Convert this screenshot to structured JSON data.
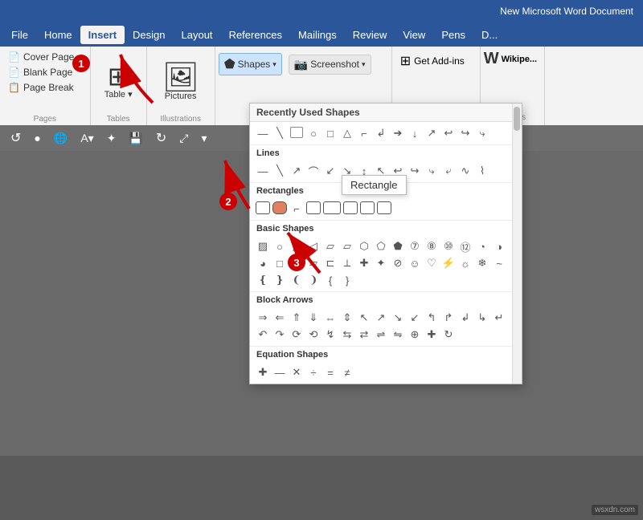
{
  "titlebar": {
    "text": "New Microsoft Word Document"
  },
  "menubar": {
    "items": [
      "File",
      "Home",
      "Insert",
      "Design",
      "Layout",
      "References",
      "Mailings",
      "Review",
      "View",
      "Pens",
      "D..."
    ]
  },
  "pages_group": {
    "label": "Pages",
    "buttons": [
      "Cover Page",
      "Blank Page",
      "Page Break"
    ]
  },
  "tables_group": {
    "label": "Tables",
    "button": "Table"
  },
  "illustrations_group": {
    "label": "Illustrations",
    "button": "Pictures"
  },
  "shapes_group": {
    "shapes_label": "Shapes",
    "screenshot_label": "Screenshot"
  },
  "addins_group": {
    "label": "Add-ins",
    "button": "Get Add-ins"
  },
  "dropdown": {
    "sections": [
      {
        "name": "Recently Used Shapes",
        "shapes": [
          "▭",
          "\\",
          "╲",
          "□",
          "○",
          "◁",
          "△",
          "⌐",
          "⌐",
          "→",
          "↓",
          "⌐",
          "⌐",
          "⌐"
        ]
      },
      {
        "name": "Lines",
        "shapes": [
          "—",
          "\\",
          "╲",
          "⌒",
          "⌒",
          "↙",
          "↘",
          "↕",
          "↖",
          "↗",
          "↩",
          "↪",
          "⤷",
          "⤶"
        ]
      },
      {
        "name": "Rectangles",
        "shapes": [
          "□",
          "▭",
          "⌐",
          "▭",
          "▭",
          "▭",
          "▭",
          "▭"
        ]
      },
      {
        "name": "Basic Shapes",
        "shapes": [
          "▨",
          "○",
          "△",
          "◁",
          "▱",
          "▱",
          "⬡",
          "⬠",
          "⬟",
          "⑦",
          "⑧",
          "⑩",
          "⑫",
          "◔",
          "◑",
          "◕",
          "□",
          "▭",
          "▱",
          "▤",
          "⊏",
          "⟂",
          "✚",
          "✦",
          "⌀",
          "☺",
          "♡",
          "☁",
          "☼",
          "❄",
          "⌁",
          "⌕",
          "❴",
          "❵",
          "❳",
          "❲",
          "❨",
          "❩",
          "❪",
          "❫",
          "❬",
          "❭"
        ]
      },
      {
        "name": "Block Arrows",
        "shapes": [
          "⇒",
          "⇐",
          "⇑",
          "⇓",
          "⇔",
          "⇕",
          "⇖",
          "⇗",
          "⇘",
          "⇙",
          "↰",
          "↱",
          "↲",
          "↳",
          "↴",
          "↵",
          "↶",
          "↷",
          "⟳",
          "⟲"
        ]
      },
      {
        "name": "Equation Shapes",
        "shapes": [
          "✚",
          "—",
          "✕",
          "÷",
          "=",
          "≠"
        ]
      }
    ],
    "tooltip": "Rectangle"
  },
  "badges": {
    "one": "1",
    "two": "2",
    "three": "3"
  },
  "watermark": "wsxdn.com",
  "wikipedia": {
    "label": "Wikipe...",
    "addins_label": "Add-ins"
  }
}
